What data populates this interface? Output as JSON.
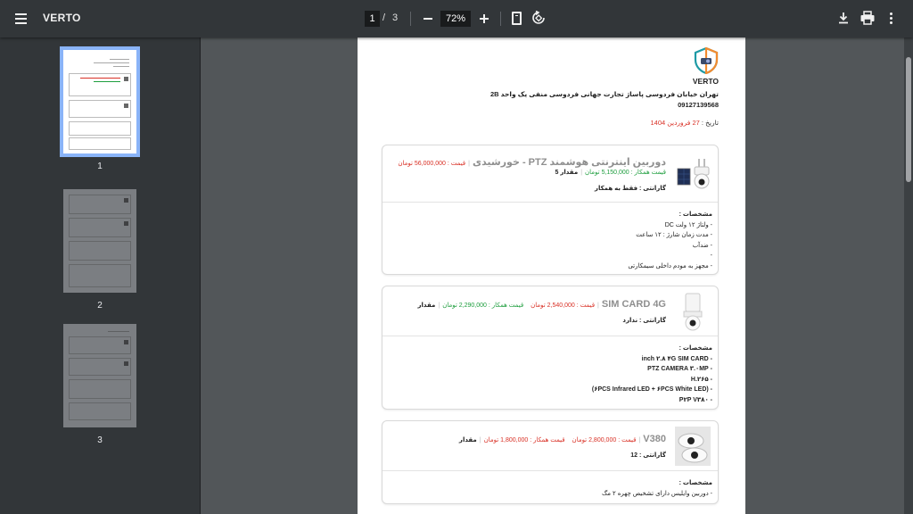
{
  "toolbar": {
    "title": "VERTO",
    "current_page": "1",
    "page_separator": "/",
    "total_pages": "3",
    "zoom": "72%"
  },
  "sidebar": {
    "thumbnails": [
      {
        "label": "1",
        "selected": true
      },
      {
        "label": "2",
        "selected": false
      },
      {
        "label": "3",
        "selected": false
      }
    ]
  },
  "document": {
    "brand": "VERTO",
    "address": "تهران خیابان فردوسی پاساژ تجارت جهانی فردوسی منفی یک واحد 2B",
    "phone": "09127139568",
    "date_label": "تاریخ :",
    "date_value": "27 فروردین 1404",
    "products": [
      {
        "name": "دوربین اینترنتی هوشمند PTZ - خورشیدی",
        "price": "قیمت : 56,000,000 تومان",
        "partner_price": "قیمت همکار : 5,150,000 تومان",
        "quantity": "مقدار 5",
        "warranty": "گارانتی : فقط به همکار",
        "specs_title": "مشخصات :",
        "specs": [
          "- ولتاژ ۱۲ ولت DC",
          "- مدت زمان شارژ : ۱۲ ساعت",
          "- ضدآب",
          "-",
          "- مجهز به مودم داخلی سیمکارتی"
        ]
      },
      {
        "name": "SIM CARD 4G",
        "price": "قیمت : 2,540,000 تومان",
        "partner_price": "قیمت همکار : 2,290,000 تومان",
        "quantity": "مقدار",
        "warranty": "گارانتی : ندارد",
        "specs_title": "مشخصات :",
        "specs": [
          "- inch ۲.۸ ۴G SIM CARD",
          "- PTZ CAMERA ۳.۰MP",
          "- H.۲۶۵",
          "- (۶PCS Infrared LED + ۶PCS White LED)",
          "- P۲P V۳۸۰"
        ]
      },
      {
        "name": "V380",
        "price": "قیمت : 2,800,000 تومان",
        "partner_price": "قیمت همکار : 1,800,000 تومان",
        "quantity": "مقدار",
        "warranty": "گارانتی : 12",
        "specs_title": "مشخصات :",
        "specs": [
          "- دوربین وایلیس دارای تشخیص چهره ۲ مگ"
        ]
      }
    ]
  },
  "icons": {
    "menu": "menu-icon",
    "zoom_out": "minus-icon",
    "zoom_in": "plus-icon",
    "fit": "fit-page-icon",
    "rotate": "rotate-icon",
    "download": "download-icon",
    "print": "print-icon",
    "more": "more-vert-icon"
  },
  "colors": {
    "toolbar_bg": "#323639",
    "viewer_bg": "#525659",
    "selected_thumb": "#8ab4f8",
    "price_red": "#d93025",
    "price_green": "#1e9e3e"
  }
}
